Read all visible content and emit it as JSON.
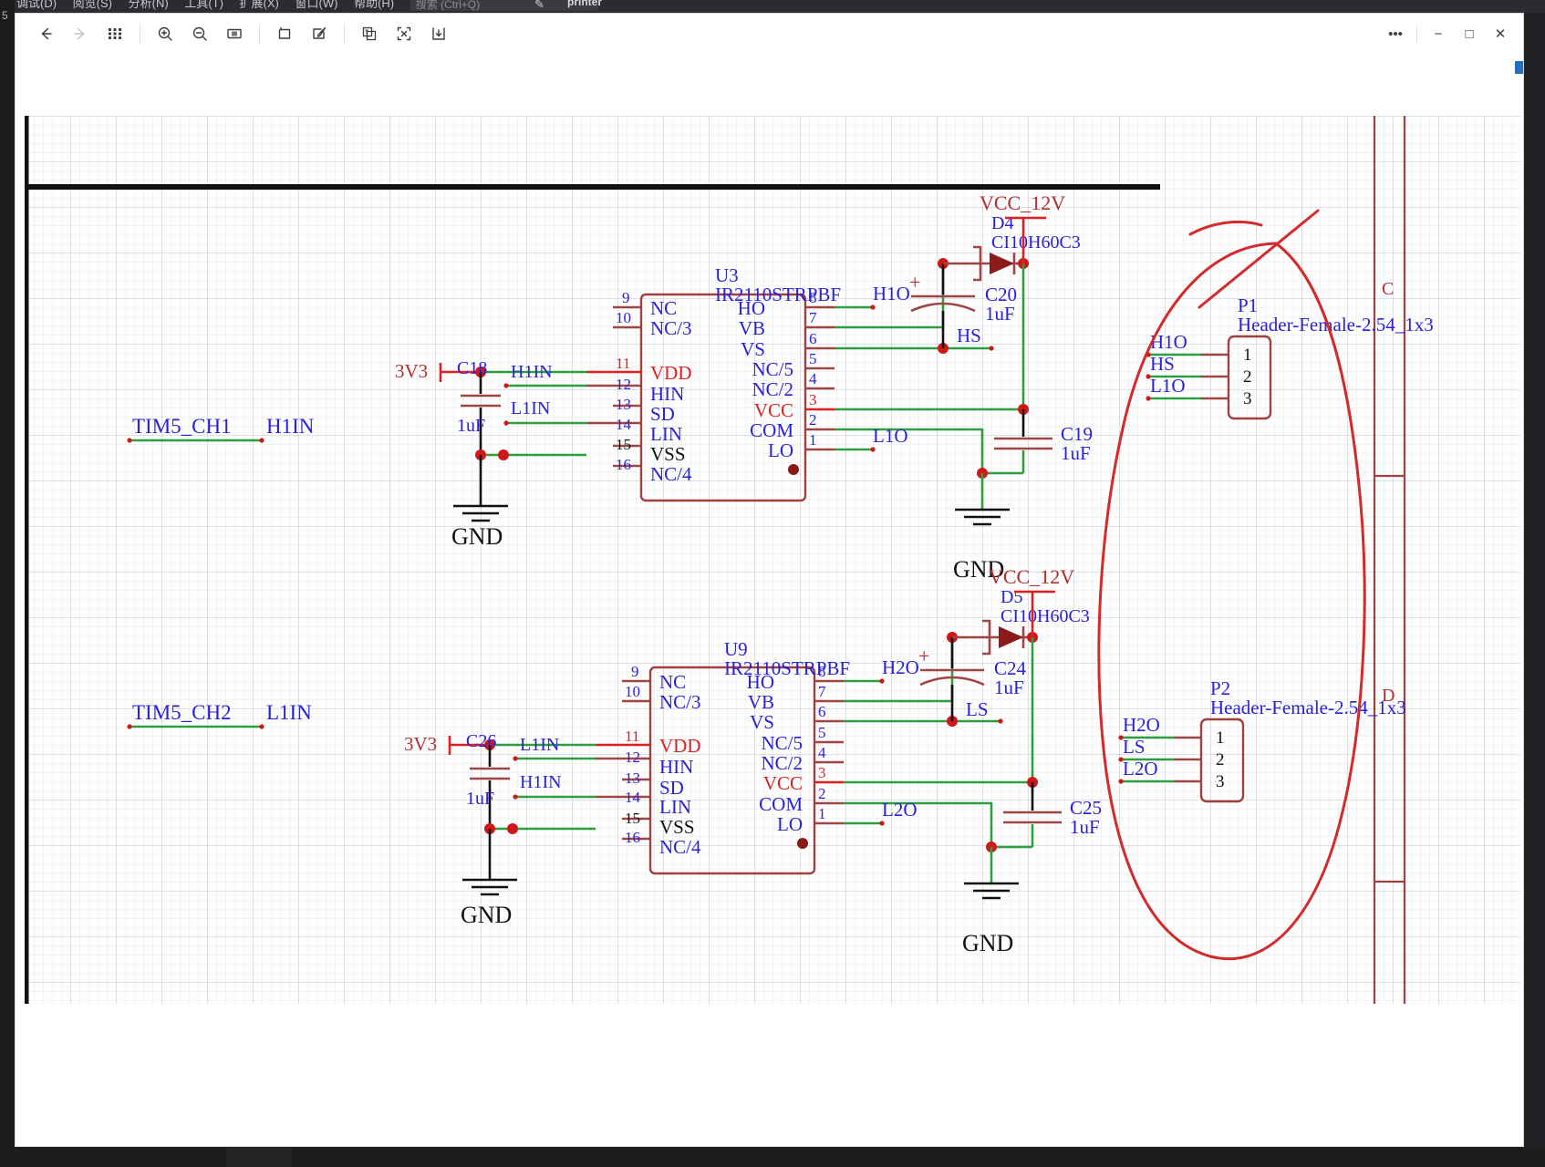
{
  "host_menubar": {
    "items": [
      "调试(D)",
      "阅览(S)",
      "分析(N)",
      "工具(T)",
      "扩展(X)",
      "窗口(W)",
      "帮助(H)"
    ],
    "search_placeholder": "搜索 (Ctrl+Q)",
    "right_label": "printer",
    "gutter_number": "5"
  },
  "toolbar": {
    "back": "back-arrow",
    "forward": "forward-arrow",
    "thumbnails": "grid-thumbnails",
    "zoom_in": "zoom-in",
    "zoom_out": "zoom-out",
    "fit_width": "fit-width",
    "crop": "crop",
    "annotate": "annotate",
    "compare": "compare",
    "select": "select-region",
    "download": "download"
  },
  "window_controls": {
    "more": "•••",
    "minimize": "−",
    "maximize": "□",
    "close": "✕"
  },
  "colors": {
    "pin_label": "#2a20d8",
    "pin_power": "#e02020",
    "component_outline": "#a04040",
    "wire": "#2f9e3f",
    "net_label": "#2a20d8",
    "power_label": "#b03030",
    "annotation": "#d42a2a",
    "gnd": "#111111"
  },
  "schematic": {
    "border_zone_labels": [
      "C",
      "D"
    ],
    "sections": [
      {
        "id": "top",
        "ic": {
          "designator": "U3",
          "part": "IR2110STRPBF",
          "left_pins": [
            {
              "num": "9",
              "name": "NC",
              "power": false
            },
            {
              "num": "10",
              "name": "NC/3",
              "power": false
            },
            {
              "num": "11",
              "name": "VDD",
              "power": true
            },
            {
              "num": "12",
              "name": "HIN",
              "power": false
            },
            {
              "num": "13",
              "name": "SD",
              "power": false
            },
            {
              "num": "14",
              "name": "LIN",
              "power": false
            },
            {
              "num": "15",
              "name": "VSS",
              "power": false
            },
            {
              "num": "16",
              "name": "NC/4",
              "power": false
            }
          ],
          "right_pins": [
            {
              "num": "8",
              "name": "HO",
              "power": false
            },
            {
              "num": "7",
              "name": "VB",
              "power": false
            },
            {
              "num": "6",
              "name": "VS",
              "power": false
            },
            {
              "num": "5",
              "name": "NC/5",
              "power": false
            },
            {
              "num": "4",
              "name": "NC/2",
              "power": false
            },
            {
              "num": "3",
              "name": "VCC",
              "power": true
            },
            {
              "num": "2",
              "name": "COM",
              "power": false
            },
            {
              "num": "1",
              "name": "LO",
              "power": false
            }
          ]
        },
        "input_net_left": "TIM5_CH1",
        "input_net_right": "H1IN",
        "rail": "3V3",
        "decoupling_cap": {
          "designator": "C18",
          "value": "1uF"
        },
        "gnd_label": "GND",
        "hin_label": "H1IN",
        "lin_label": "L1IN",
        "power_rail": "VCC_12V",
        "diode": {
          "designator": "D4",
          "part": "CI10H60C3"
        },
        "boot_cap": {
          "designator": "C20",
          "value": "1uF"
        },
        "vcc_cap": {
          "designator": "C19",
          "value": "1uF"
        },
        "out_labels": {
          "ho": "H1O",
          "vs": "HS",
          "lo": "L1O"
        },
        "gnd_label2": "GND",
        "header": {
          "designator": "P1",
          "part": "Header-Female-2.54_1x3",
          "pins": [
            "1",
            "2",
            "3"
          ],
          "nets": [
            "H1O",
            "HS",
            "L1O"
          ]
        }
      },
      {
        "id": "bottom",
        "ic": {
          "designator": "U9",
          "part": "IR2110STRPBF",
          "left_pins": [
            {
              "num": "9",
              "name": "NC",
              "power": false
            },
            {
              "num": "10",
              "name": "NC/3",
              "power": false
            },
            {
              "num": "11",
              "name": "VDD",
              "power": true
            },
            {
              "num": "12",
              "name": "HIN",
              "power": false
            },
            {
              "num": "13",
              "name": "SD",
              "power": false
            },
            {
              "num": "14",
              "name": "LIN",
              "power": false
            },
            {
              "num": "15",
              "name": "VSS",
              "power": false
            },
            {
              "num": "16",
              "name": "NC/4",
              "power": false
            }
          ],
          "right_pins": [
            {
              "num": "8",
              "name": "HO",
              "power": false
            },
            {
              "num": "7",
              "name": "VB",
              "power": false
            },
            {
              "num": "6",
              "name": "VS",
              "power": false
            },
            {
              "num": "5",
              "name": "NC/5",
              "power": false
            },
            {
              "num": "4",
              "name": "NC/2",
              "power": false
            },
            {
              "num": "3",
              "name": "VCC",
              "power": true
            },
            {
              "num": "2",
              "name": "COM",
              "power": false
            },
            {
              "num": "1",
              "name": "LO",
              "power": false
            }
          ]
        },
        "input_net_left": "TIM5_CH2",
        "input_net_right": "L1IN",
        "rail": "3V3",
        "decoupling_cap": {
          "designator": "C26",
          "value": "1uF"
        },
        "gnd_label": "GND",
        "hin_label": "H1IN",
        "lin_label": "L1IN",
        "power_rail": "VCC_12V",
        "diode": {
          "designator": "D5",
          "part": "CI10H60C3"
        },
        "boot_cap": {
          "designator": "C24",
          "value": "1uF"
        },
        "vcc_cap": {
          "designator": "C25",
          "value": "1uF"
        },
        "out_labels": {
          "ho": "H2O",
          "vs": "LS",
          "lo": "L2O"
        },
        "gnd_label2": "GND",
        "header": {
          "designator": "P2",
          "part": "Header-Female-2.54_1x3",
          "pins": [
            "1",
            "2",
            "3"
          ],
          "nets": [
            "H2O",
            "LS",
            "L2O"
          ]
        }
      }
    ],
    "annotation": {
      "shape": "hand-drawn-oval-with-cross",
      "color": "#d42a2a"
    }
  }
}
